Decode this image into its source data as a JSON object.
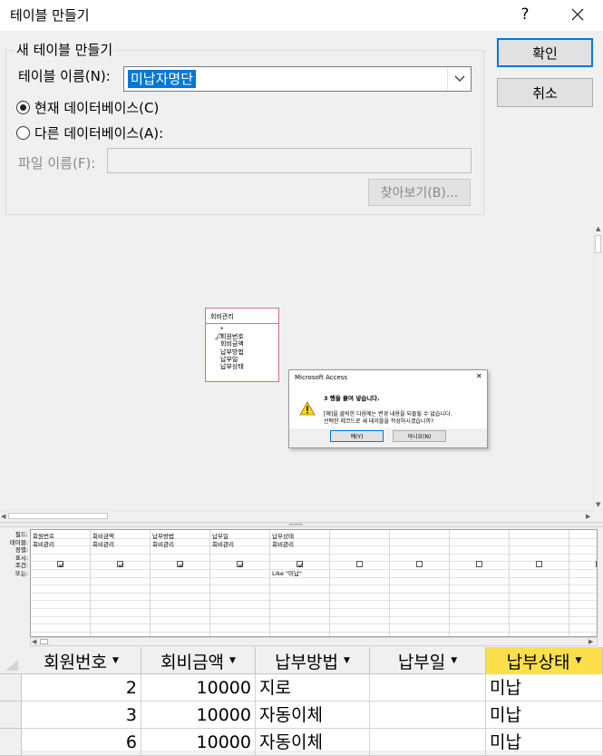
{
  "dialog": {
    "title": "테이블 만들기",
    "help": "?",
    "group_title": "새 테이블 만들기",
    "table_name_label": "테이블 이름(N):",
    "table_name_value": "미납자명단",
    "radio_current": "현재 데이터베이스(C)",
    "radio_other": "다른 데이터베이스(A):",
    "file_name_label": "파일 이름(F):",
    "browse_button": "찾아보기(B)...",
    "ok_button": "확인",
    "cancel_button": "취소"
  },
  "design": {
    "table": {
      "name": "회비관리",
      "fields": [
        "*",
        "회원번호",
        "회비금액",
        "납부방법",
        "납부일",
        "납부상태"
      ]
    }
  },
  "msgbox": {
    "title": "Microsoft Access",
    "headline": "3 행을 붙여 넣습니다.",
    "line1": "[예]을 클릭한 다음에는 변경 내용을 되돌릴 수 없습니다.",
    "line2": "선택한 레코드로 새 테이블을 작성하시겠습니까?",
    "yes_button": "예(Y)",
    "no_button": "아니요(N)"
  },
  "qbe": {
    "row_labels": [
      "필드:",
      "테이블:",
      "정렬:",
      "표시:",
      "조건:",
      "또는:"
    ],
    "columns": [
      {
        "field": "회원번호",
        "table": "회비관리",
        "show": true,
        "criteria": ""
      },
      {
        "field": "회비금액",
        "table": "회비관리",
        "show": true,
        "criteria": ""
      },
      {
        "field": "납부방법",
        "table": "회비관리",
        "show": true,
        "criteria": ""
      },
      {
        "field": "납부일",
        "table": "회비관리",
        "show": true,
        "criteria": ""
      },
      {
        "field": "납부상태",
        "table": "회비관리",
        "show": true,
        "criteria": "Like \"미납\""
      },
      {
        "field": "",
        "table": "",
        "show": false,
        "criteria": ""
      },
      {
        "field": "",
        "table": "",
        "show": false,
        "criteria": ""
      },
      {
        "field": "",
        "table": "",
        "show": false,
        "criteria": ""
      },
      {
        "field": "",
        "table": "",
        "show": false,
        "criteria": ""
      },
      {
        "field": "",
        "table": "",
        "show": false,
        "criteria": ""
      }
    ]
  },
  "datasheet": {
    "headers": [
      "회원번호",
      "회비금액",
      "납부방법",
      "납부일",
      "납부상태"
    ],
    "rows": [
      [
        "2",
        "10000",
        "지로",
        "",
        "미납"
      ],
      [
        "3",
        "10000",
        "자동이체",
        "",
        "미납"
      ],
      [
        "6",
        "10000",
        "자동이체",
        "",
        "미납"
      ]
    ]
  },
  "colors": {
    "accent": "#0078d7",
    "selected_header": "#fbe04c",
    "table_border": "#d0737c"
  }
}
